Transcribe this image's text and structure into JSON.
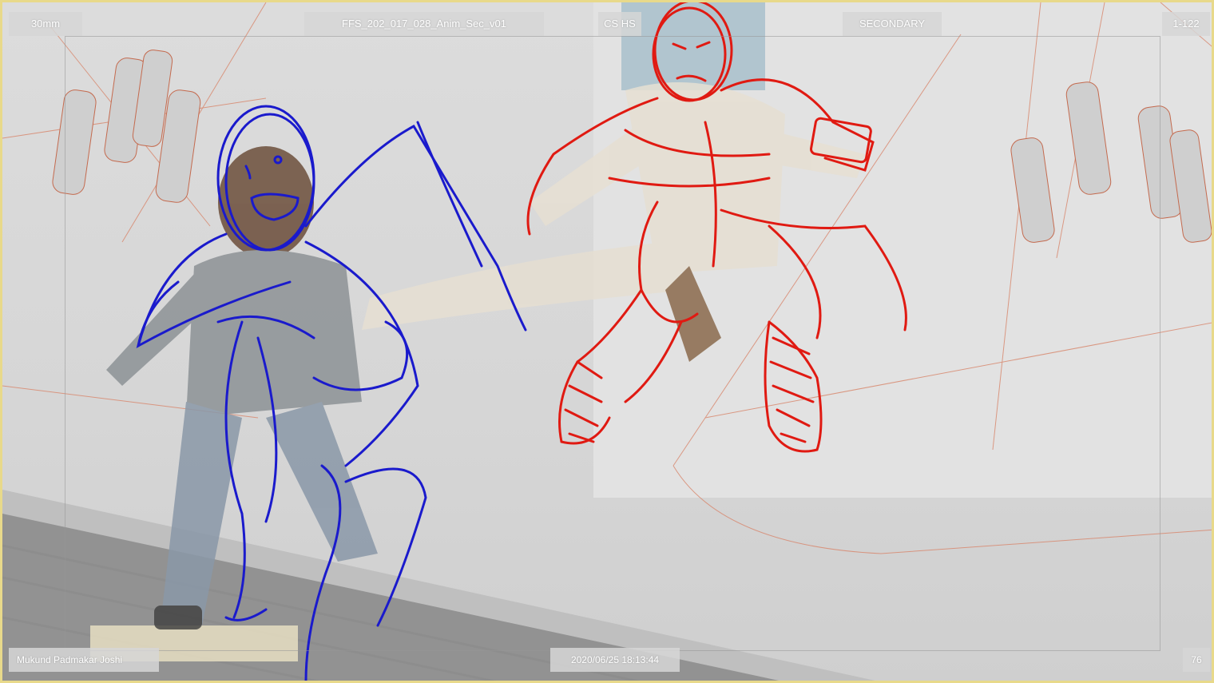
{
  "hud": {
    "lens": "30mm",
    "shot_name": "FFS_202_017_028_Anim_Sec_v01",
    "camera": "CS HS",
    "pass": "SECONDARY",
    "frame_range": "1-122",
    "artist": "Mukund Padmakar Joshi",
    "timestamp": "2020/06/25 18:13:44",
    "current_frame": "76"
  },
  "colors": {
    "frame_border": "#e8d98a",
    "hud_bg": "#d6d6d6",
    "hud_text": "#ffffff",
    "sketch_blue": "#1a1acc",
    "sketch_red": "#e01a12",
    "rig_orange": "#d8856a"
  }
}
